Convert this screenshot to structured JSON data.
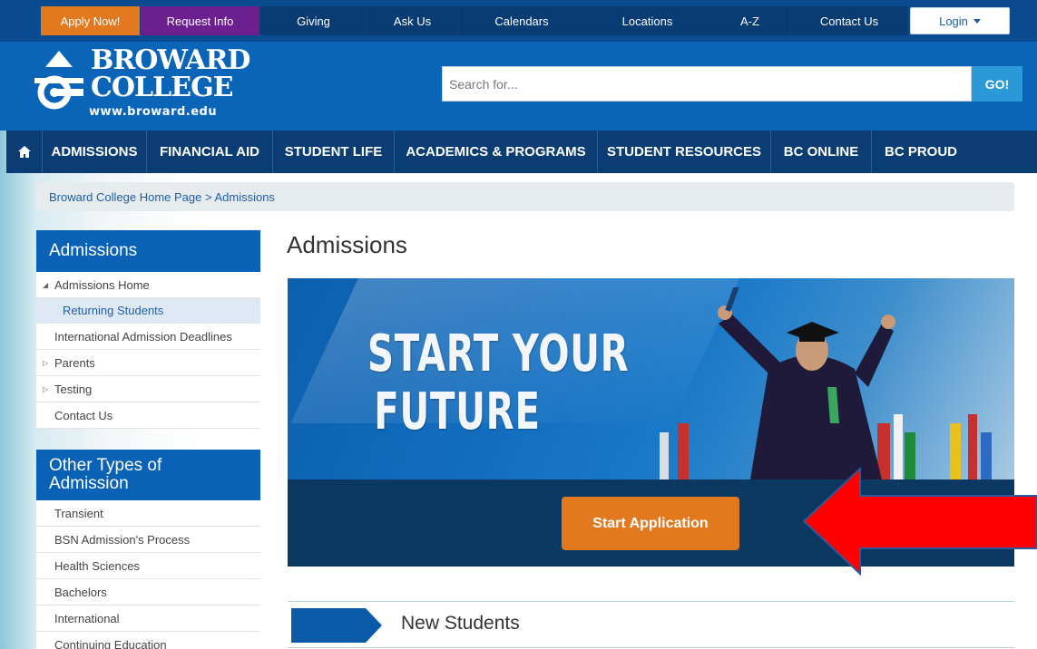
{
  "utility_nav": {
    "apply": "Apply Now!",
    "request": "Request Info",
    "giving": "Giving",
    "ask": "Ask Us",
    "calendars": "Calendars",
    "locations": "Locations",
    "az": "A-Z",
    "contact": "Contact Us",
    "login": "Login"
  },
  "brand": {
    "line1": "BROWARD",
    "line2": "COLLEGE",
    "url": "www.broward.edu"
  },
  "search": {
    "placeholder": "Search for...",
    "button": "GO!"
  },
  "main_nav": {
    "home_icon": "home-icon",
    "admissions": "ADMISSIONS",
    "financial_aid": "FINANCIAL AID",
    "student_life": "STUDENT LIFE",
    "academics": "ACADEMICS & PROGRAMS",
    "resources": "STUDENT RESOURCES",
    "online": "BC ONLINE",
    "proud": "BC PROUD"
  },
  "breadcrumb": "Broward College Home Page > Admissions",
  "sidebar": {
    "admissions_title": "Admissions",
    "admissions_items": {
      "home": "Admissions Home",
      "returning": "Returning Students",
      "intl_deadlines": "International Admission Deadlines",
      "parents": "Parents",
      "testing": "Testing",
      "contact": "Contact Us"
    },
    "other_title_1": "Other Types of",
    "other_title_2": "Admission",
    "other_items": {
      "transient": "Transient",
      "bsn": "BSN Admission's Process",
      "health": "Health Sciences",
      "bachelors": "Bachelors",
      "international": "International",
      "continuing": "Continuing Education"
    }
  },
  "content": {
    "title": "Admissions",
    "hero_line1": "START YOUR",
    "hero_line2": "FUTURE",
    "cta": "Start Application",
    "section_title": "New Students"
  },
  "colors": {
    "orange": "#e3791e",
    "purple": "#6c1f8f",
    "navy": "#0b3d74",
    "brand_blue": "#0a64b8",
    "annotation_red": "#ff0000"
  }
}
